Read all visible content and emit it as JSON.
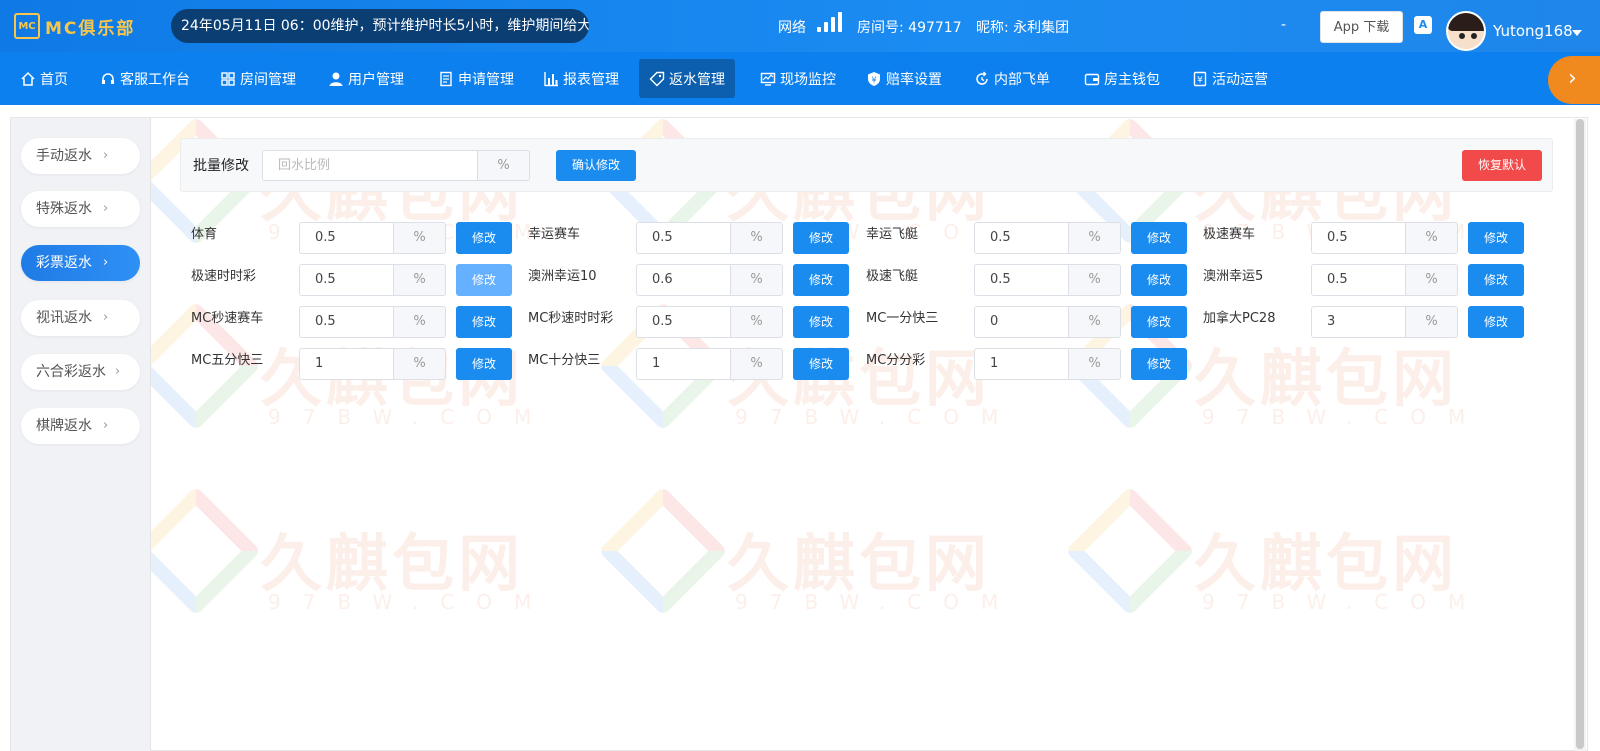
{
  "header": {
    "logo_mark": "MC",
    "logo_mc": "MC",
    "logo_rest": "俱乐部",
    "marquee": "24年05月11日 06：00维护，预计维护时长5小时，维护期间给大",
    "network_label": "网络",
    "room_label": "房间号: 497717",
    "nickname_label": "昵称: 永利集团",
    "dash": "-",
    "app_download": "App 下载",
    "lang_icon": "A",
    "username": "Yutong168"
  },
  "nav": {
    "items": [
      {
        "label": "首页",
        "icon": "home-icon"
      },
      {
        "label": "客服工作台",
        "icon": "headset-icon"
      },
      {
        "label": "房间管理",
        "icon": "grid-icon"
      },
      {
        "label": "用户管理",
        "icon": "user-icon"
      },
      {
        "label": "申请管理",
        "icon": "document-icon"
      },
      {
        "label": "报表管理",
        "icon": "bar-chart-icon"
      },
      {
        "label": "返水管理",
        "icon": "tag-icon",
        "active": true
      },
      {
        "label": "现场监控",
        "icon": "monitor-icon"
      },
      {
        "label": "赔率设置",
        "icon": "shield-yen-icon"
      },
      {
        "label": "内部飞单",
        "icon": "refresh-icon"
      },
      {
        "label": "房主钱包",
        "icon": "wallet-icon"
      },
      {
        "label": "活动运营",
        "icon": "yen-doc-icon"
      }
    ],
    "next_arrow": "›"
  },
  "sidebar": {
    "items": [
      {
        "label": "手动返水"
      },
      {
        "label": "特殊返水"
      },
      {
        "label": "彩票返水",
        "active": true
      },
      {
        "label": "视讯返水"
      },
      {
        "label": "六合彩返水"
      },
      {
        "label": "棋牌返水"
      }
    ],
    "chevron": "›"
  },
  "batch": {
    "label": "批量修改",
    "placeholder": "回水比例",
    "unit": "%",
    "confirm": "确认修改",
    "reset": "恢复默认"
  },
  "rebates": {
    "unit": "%",
    "button": "修改",
    "items": [
      {
        "label": "体育",
        "value": "0.5"
      },
      {
        "label": "幸运赛车",
        "value": "0.5"
      },
      {
        "label": "幸运飞艇",
        "value": "0.5"
      },
      {
        "label": "极速赛车",
        "value": "0.5"
      },
      {
        "label": "极速时时彩",
        "value": "0.5"
      },
      {
        "label": "澳洲幸运10",
        "value": "0.6"
      },
      {
        "label": "极速飞艇",
        "value": "0.5"
      },
      {
        "label": "澳洲幸运5",
        "value": "0.5"
      },
      {
        "label": "MC秒速赛车",
        "value": "0.5"
      },
      {
        "label": "MC秒速时时彩",
        "value": "0.5"
      },
      {
        "label": "MC一分快三",
        "value": "0"
      },
      {
        "label": "加拿大PC28",
        "value": "3"
      },
      {
        "label": "MC五分快三",
        "value": "1"
      },
      {
        "label": "MC十分快三",
        "value": "1"
      },
      {
        "label": "MC分分彩",
        "value": "1"
      }
    ]
  },
  "watermark": {
    "text": "久麒包网",
    "sub": "97BW.COM"
  },
  "colors": {
    "primary": "#1a8cf0",
    "nav_bg": "#0d80ef",
    "danger": "#f24a4a",
    "accent_orange": "#f08a1e",
    "logo_gold": "#f7c64a"
  }
}
